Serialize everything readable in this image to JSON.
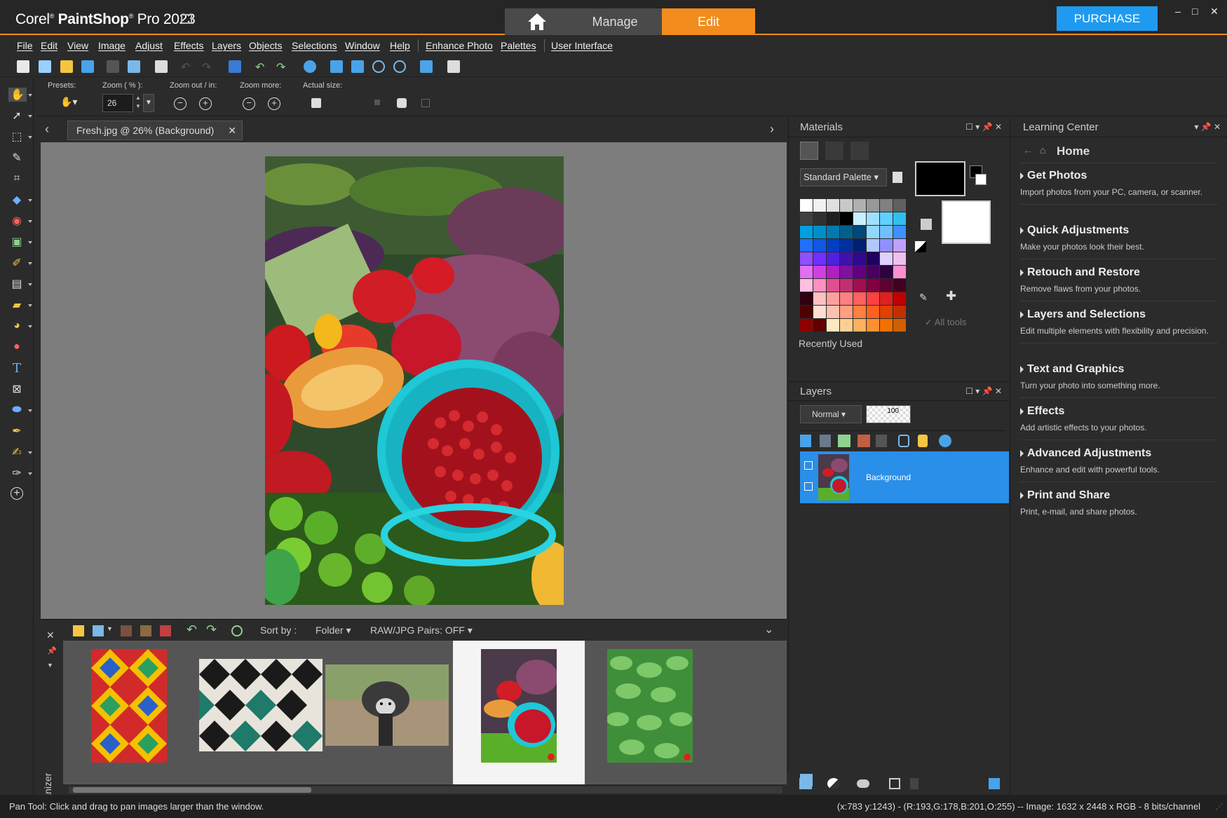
{
  "app": {
    "brand": "Corel",
    "product": "PaintShop",
    "pro_label": "Pro 2023",
    "tabs": {
      "manage": "Manage",
      "edit": "Edit"
    },
    "purchase": "PURCHASE",
    "window_controls": {
      "minimize": "–",
      "maximize": "□",
      "close": "✕"
    }
  },
  "menu": [
    "File",
    "Edit",
    "View",
    "Image",
    "Adjust",
    "Effects",
    "Layers",
    "Objects",
    "Selections",
    "Window",
    "Help",
    "Enhance Photo",
    "Palettes",
    "User Interface"
  ],
  "options": {
    "presets_label": "Presets:",
    "zoom_label": "Zoom ( % ):",
    "zoom_value": "26",
    "zoom_out_in_label": "Zoom out / in:",
    "zoom_more_label": "Zoom more:",
    "actual_size_label": "Actual size:"
  },
  "document": {
    "tab_label": "Fresh.jpg @  26% (Background)",
    "nav_prev": "‹",
    "nav_next": "›"
  },
  "organizer": {
    "side_label": "Organizer",
    "sort_label": "Sort by :",
    "sort_value": "Folder",
    "raw_jpg": "RAW/JPG Pairs: OFF",
    "selected_index": 3
  },
  "status": {
    "left": "Pan Tool: Click and drag to pan images larger than the window.",
    "right": "(x:783 y:1243) - (R:193,G:178,B:201,O:255) -- Image:  1632 x 2448 x RGB - 8 bits/channel"
  },
  "materials": {
    "title": "Materials",
    "palette_select": "Standard Palette",
    "recently_used": "Recently Used",
    "all_tools": "All tools",
    "swatches": [
      "#ffffff",
      "#f2f2f2",
      "#e0e0e0",
      "#c8c8c8",
      "#b0b0b0",
      "#989898",
      "#808080",
      "#606060",
      "#404040",
      "#303030",
      "#202020",
      "#000000",
      "#c8f0ff",
      "#a0e0ff",
      "#60d0ff",
      "#30c0f0",
      "#00a0e0",
      "#0090c8",
      "#007ab0",
      "#006090",
      "#004878",
      "#90d8ff",
      "#70c0ff",
      "#4090ff",
      "#2070ff",
      "#1058e0",
      "#0040c0",
      "#0030a0",
      "#002070",
      "#b0c8ff",
      "#9090ff",
      "#c0a0ff",
      "#9050ff",
      "#7030ff",
      "#5020e0",
      "#4010b0",
      "#300890",
      "#200060",
      "#e0d0ff",
      "#f0c0f0",
      "#e070f0",
      "#d040e0",
      "#b020c0",
      "#8010a0",
      "#600080",
      "#480060",
      "#300040",
      "#ff90d0",
      "#ffc0e0",
      "#ff90c0",
      "#e05090",
      "#c03070",
      "#a01050",
      "#800040",
      "#600030",
      "#400020",
      "#300010",
      "#ffc0c0",
      "#ffa0a0",
      "#ff8080",
      "#ff6060",
      "#ff4040",
      "#e02020",
      "#c00000",
      "#500000",
      "#ffe0d0",
      "#ffc0b0",
      "#ffa080",
      "#ff8040",
      "#ff6020",
      "#e04000",
      "#c03000",
      "#900000",
      "#600000",
      "#ffe8c0",
      "#ffd090",
      "#ffb060",
      "#ff9030",
      "#f07000",
      "#d06000"
    ]
  },
  "layers": {
    "title": "Layers",
    "blend_mode": "Normal",
    "opacity": "100",
    "layer_name": "Background"
  },
  "learning": {
    "title": "Learning Center",
    "home": "Home",
    "items": [
      {
        "title": "Get Photos",
        "desc": "Import photos from your PC, camera, or scanner."
      },
      {
        "title": "Quick Adjustments",
        "desc": "Make your photos look their best."
      },
      {
        "title": "Retouch and Restore",
        "desc": "Remove flaws from your photos."
      },
      {
        "title": "Layers and Selections",
        "desc": "Edit multiple elements with flexibility and precision."
      },
      {
        "title": "Text and Graphics",
        "desc": "Turn your photo into something more."
      },
      {
        "title": "Effects",
        "desc": "Add artistic effects to your photos."
      },
      {
        "title": "Advanced Adjustments",
        "desc": "Enhance and edit with powerful tools."
      },
      {
        "title": "Print and Share",
        "desc": "Print, e-mail, and share photos."
      }
    ]
  },
  "colors": {
    "accent": "#f28c1c",
    "selection": "#2a8fe8",
    "purchase": "#1e9bf0"
  }
}
